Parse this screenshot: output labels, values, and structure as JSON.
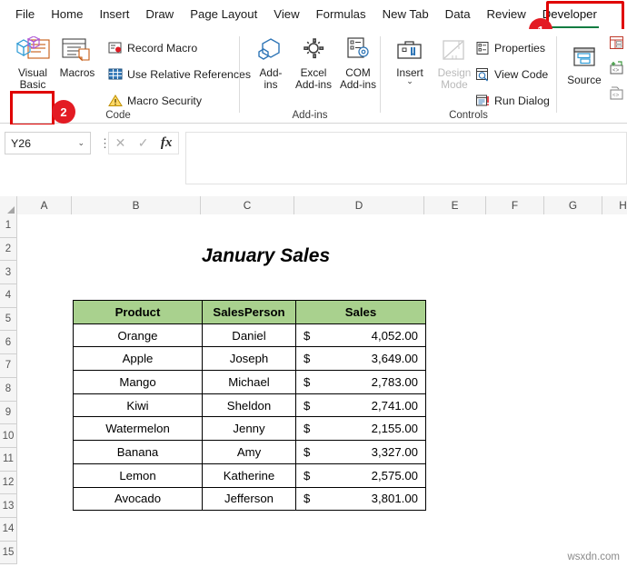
{
  "ribbon": {
    "tabs": [
      {
        "label": "File",
        "active": false
      },
      {
        "label": "Home",
        "active": false
      },
      {
        "label": "Insert",
        "active": false
      },
      {
        "label": "Draw",
        "active": false
      },
      {
        "label": "Page Layout",
        "active": false
      },
      {
        "label": "View",
        "active": false
      },
      {
        "label": "Formulas",
        "active": false
      },
      {
        "label": "New Tab",
        "active": false
      },
      {
        "label": "Data",
        "active": false
      },
      {
        "label": "Review",
        "active": false
      },
      {
        "label": "Developer",
        "active": true
      }
    ],
    "callouts": [
      {
        "number": "1",
        "target": "developer-tab"
      },
      {
        "number": "2",
        "target": "visual-basic-button"
      }
    ],
    "highlight_color": "#e00000",
    "accent_color": "#107c41",
    "groups": [
      {
        "name": "Code",
        "label": "Code",
        "big_buttons": [
          {
            "label_line1": "Visual",
            "label_line2": "Basic",
            "icon": "visual-basic-icon",
            "disabled": false
          },
          {
            "label_line1": "Macros",
            "label_line2": "",
            "icon": "macros-icon",
            "disabled": false
          }
        ],
        "small_buttons": [
          {
            "label": "Record Macro",
            "icon": "record-macro-icon"
          },
          {
            "label": "Use Relative References",
            "icon": "relative-references-icon"
          },
          {
            "label": "Macro Security",
            "icon": "macro-security-warning-icon"
          }
        ]
      },
      {
        "name": "Add-ins",
        "label": "Add-ins",
        "big_buttons": [
          {
            "label_line1": "Add-",
            "label_line2": "ins",
            "icon": "add-ins-icon",
            "disabled": false
          },
          {
            "label_line1": "Excel",
            "label_line2": "Add-ins",
            "icon": "excel-add-ins-icon",
            "disabled": false
          },
          {
            "label_line1": "COM",
            "label_line2": "Add-ins",
            "icon": "com-add-ins-icon",
            "disabled": false
          }
        ],
        "small_buttons": []
      },
      {
        "name": "Controls",
        "label": "Controls",
        "big_buttons": [
          {
            "label_line1": "Insert",
            "label_line2": "",
            "icon": "insert-control-icon",
            "disabled": false,
            "has_dropdown": true
          },
          {
            "label_line1": "Design",
            "label_line2": "Mode",
            "icon": "design-mode-icon",
            "disabled": true
          }
        ],
        "small_buttons": [
          {
            "label": "Properties",
            "icon": "properties-icon"
          },
          {
            "label": "View Code",
            "icon": "view-code-icon"
          },
          {
            "label": "Run Dialog",
            "icon": "run-dialog-icon"
          }
        ]
      },
      {
        "name": "XML",
        "label": "",
        "big_buttons": [
          {
            "label_line1": "Source",
            "label_line2": "",
            "icon": "xml-source-icon",
            "disabled": false
          }
        ],
        "small_buttons": [
          {
            "label": "",
            "icon": "map-properties-icon"
          },
          {
            "label": "",
            "icon": "expansion-packs-icon"
          },
          {
            "label": "",
            "icon": "refresh-data-icon"
          }
        ]
      }
    ]
  },
  "formula_bar": {
    "name_box_value": "Y26",
    "cancel_icon": "cancel-x-icon",
    "enter_icon": "enter-check-icon",
    "function_icon": "insert-function-fx-icon",
    "formula_value": ""
  },
  "grid": {
    "columns": [
      "A",
      "B",
      "C",
      "D",
      "E",
      "F",
      "G",
      "H"
    ],
    "rows": [
      "1",
      "2",
      "3",
      "4",
      "5",
      "6",
      "7",
      "8",
      "9",
      "10",
      "11",
      "12",
      "13",
      "14",
      "15"
    ],
    "sheet_title": "January Sales",
    "table": {
      "headers": [
        "Product",
        "SalesPerson",
        "Sales"
      ],
      "header_fill": "#a9d18e",
      "rows": [
        {
          "product": "Orange",
          "person": "Daniel",
          "currency": "$",
          "amount": "4,052.00"
        },
        {
          "product": "Apple",
          "person": "Joseph",
          "currency": "$",
          "amount": "3,649.00"
        },
        {
          "product": "Mango",
          "person": "Michael",
          "currency": "$",
          "amount": "2,783.00"
        },
        {
          "product": "Kiwi",
          "person": "Sheldon",
          "currency": "$",
          "amount": "2,741.00"
        },
        {
          "product": "Watermelon",
          "person": "Jenny",
          "currency": "$",
          "amount": "2,155.00"
        },
        {
          "product": "Banana",
          "person": "Amy",
          "currency": "$",
          "amount": "3,327.00"
        },
        {
          "product": "Lemon",
          "person": "Katherine",
          "currency": "$",
          "amount": "2,575.00"
        },
        {
          "product": "Avocado",
          "person": "Jefferson",
          "currency": "$",
          "amount": "3,801.00"
        }
      ]
    }
  },
  "watermark": "wsxdn.com"
}
